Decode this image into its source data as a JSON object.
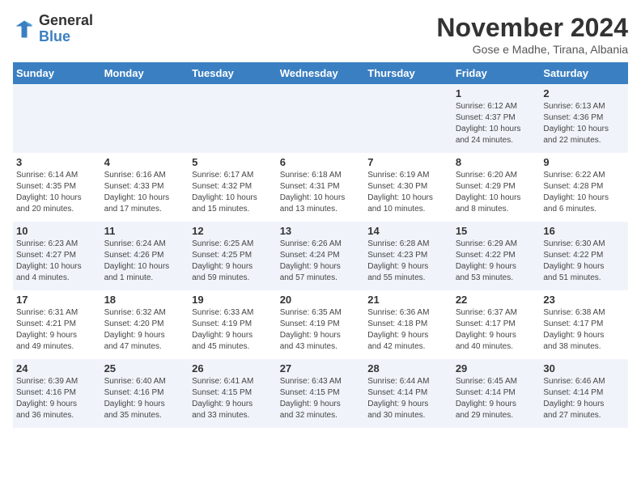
{
  "header": {
    "logo_general": "General",
    "logo_blue": "Blue",
    "month_title": "November 2024",
    "subtitle": "Gose e Madhe, Tirana, Albania"
  },
  "weekdays": [
    "Sunday",
    "Monday",
    "Tuesday",
    "Wednesday",
    "Thursday",
    "Friday",
    "Saturday"
  ],
  "weeks": [
    [
      {
        "day": "",
        "info": ""
      },
      {
        "day": "",
        "info": ""
      },
      {
        "day": "",
        "info": ""
      },
      {
        "day": "",
        "info": ""
      },
      {
        "day": "",
        "info": ""
      },
      {
        "day": "1",
        "info": "Sunrise: 6:12 AM\nSunset: 4:37 PM\nDaylight: 10 hours\nand 24 minutes."
      },
      {
        "day": "2",
        "info": "Sunrise: 6:13 AM\nSunset: 4:36 PM\nDaylight: 10 hours\nand 22 minutes."
      }
    ],
    [
      {
        "day": "3",
        "info": "Sunrise: 6:14 AM\nSunset: 4:35 PM\nDaylight: 10 hours\nand 20 minutes."
      },
      {
        "day": "4",
        "info": "Sunrise: 6:16 AM\nSunset: 4:33 PM\nDaylight: 10 hours\nand 17 minutes."
      },
      {
        "day": "5",
        "info": "Sunrise: 6:17 AM\nSunset: 4:32 PM\nDaylight: 10 hours\nand 15 minutes."
      },
      {
        "day": "6",
        "info": "Sunrise: 6:18 AM\nSunset: 4:31 PM\nDaylight: 10 hours\nand 13 minutes."
      },
      {
        "day": "7",
        "info": "Sunrise: 6:19 AM\nSunset: 4:30 PM\nDaylight: 10 hours\nand 10 minutes."
      },
      {
        "day": "8",
        "info": "Sunrise: 6:20 AM\nSunset: 4:29 PM\nDaylight: 10 hours\nand 8 minutes."
      },
      {
        "day": "9",
        "info": "Sunrise: 6:22 AM\nSunset: 4:28 PM\nDaylight: 10 hours\nand 6 minutes."
      }
    ],
    [
      {
        "day": "10",
        "info": "Sunrise: 6:23 AM\nSunset: 4:27 PM\nDaylight: 10 hours\nand 4 minutes."
      },
      {
        "day": "11",
        "info": "Sunrise: 6:24 AM\nSunset: 4:26 PM\nDaylight: 10 hours\nand 1 minute."
      },
      {
        "day": "12",
        "info": "Sunrise: 6:25 AM\nSunset: 4:25 PM\nDaylight: 9 hours\nand 59 minutes."
      },
      {
        "day": "13",
        "info": "Sunrise: 6:26 AM\nSunset: 4:24 PM\nDaylight: 9 hours\nand 57 minutes."
      },
      {
        "day": "14",
        "info": "Sunrise: 6:28 AM\nSunset: 4:23 PM\nDaylight: 9 hours\nand 55 minutes."
      },
      {
        "day": "15",
        "info": "Sunrise: 6:29 AM\nSunset: 4:22 PM\nDaylight: 9 hours\nand 53 minutes."
      },
      {
        "day": "16",
        "info": "Sunrise: 6:30 AM\nSunset: 4:22 PM\nDaylight: 9 hours\nand 51 minutes."
      }
    ],
    [
      {
        "day": "17",
        "info": "Sunrise: 6:31 AM\nSunset: 4:21 PM\nDaylight: 9 hours\nand 49 minutes."
      },
      {
        "day": "18",
        "info": "Sunrise: 6:32 AM\nSunset: 4:20 PM\nDaylight: 9 hours\nand 47 minutes."
      },
      {
        "day": "19",
        "info": "Sunrise: 6:33 AM\nSunset: 4:19 PM\nDaylight: 9 hours\nand 45 minutes."
      },
      {
        "day": "20",
        "info": "Sunrise: 6:35 AM\nSunset: 4:19 PM\nDaylight: 9 hours\nand 43 minutes."
      },
      {
        "day": "21",
        "info": "Sunrise: 6:36 AM\nSunset: 4:18 PM\nDaylight: 9 hours\nand 42 minutes."
      },
      {
        "day": "22",
        "info": "Sunrise: 6:37 AM\nSunset: 4:17 PM\nDaylight: 9 hours\nand 40 minutes."
      },
      {
        "day": "23",
        "info": "Sunrise: 6:38 AM\nSunset: 4:17 PM\nDaylight: 9 hours\nand 38 minutes."
      }
    ],
    [
      {
        "day": "24",
        "info": "Sunrise: 6:39 AM\nSunset: 4:16 PM\nDaylight: 9 hours\nand 36 minutes."
      },
      {
        "day": "25",
        "info": "Sunrise: 6:40 AM\nSunset: 4:16 PM\nDaylight: 9 hours\nand 35 minutes."
      },
      {
        "day": "26",
        "info": "Sunrise: 6:41 AM\nSunset: 4:15 PM\nDaylight: 9 hours\nand 33 minutes."
      },
      {
        "day": "27",
        "info": "Sunrise: 6:43 AM\nSunset: 4:15 PM\nDaylight: 9 hours\nand 32 minutes."
      },
      {
        "day": "28",
        "info": "Sunrise: 6:44 AM\nSunset: 4:14 PM\nDaylight: 9 hours\nand 30 minutes."
      },
      {
        "day": "29",
        "info": "Sunrise: 6:45 AM\nSunset: 4:14 PM\nDaylight: 9 hours\nand 29 minutes."
      },
      {
        "day": "30",
        "info": "Sunrise: 6:46 AM\nSunset: 4:14 PM\nDaylight: 9 hours\nand 27 minutes."
      }
    ]
  ]
}
